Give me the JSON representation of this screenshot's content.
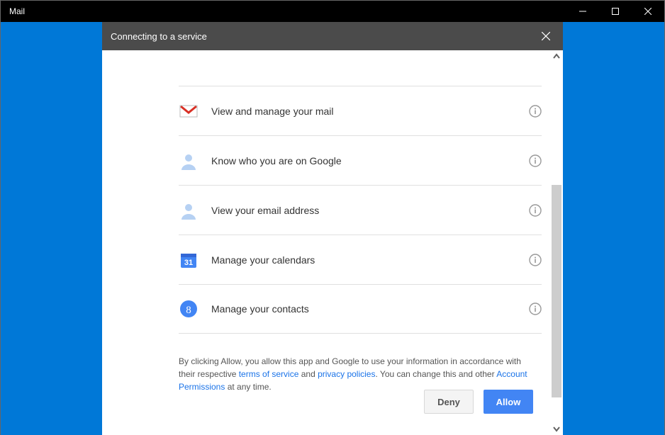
{
  "titlebar": {
    "title": "Mail"
  },
  "dialog": {
    "title": "Connecting to a service",
    "permissions": [
      {
        "icon": "gmail",
        "label": "View and manage your mail"
      },
      {
        "icon": "person",
        "label": "Know who you are on Google"
      },
      {
        "icon": "person",
        "label": "View your email address"
      },
      {
        "icon": "calendar",
        "label": "Manage your calendars"
      },
      {
        "icon": "contact",
        "label": "Manage your contacts"
      }
    ],
    "consent": {
      "pre": "By clicking Allow, you allow this app and Google to use your information in accordance with their respective ",
      "tos": "terms of service",
      "and": " and ",
      "privacy": "privacy policies",
      "post1": ". You can change this and other ",
      "account_perms": "Account Permissions",
      "post2": " at any time."
    },
    "buttons": {
      "deny": "Deny",
      "allow": "Allow"
    },
    "calendar_day": "31"
  }
}
